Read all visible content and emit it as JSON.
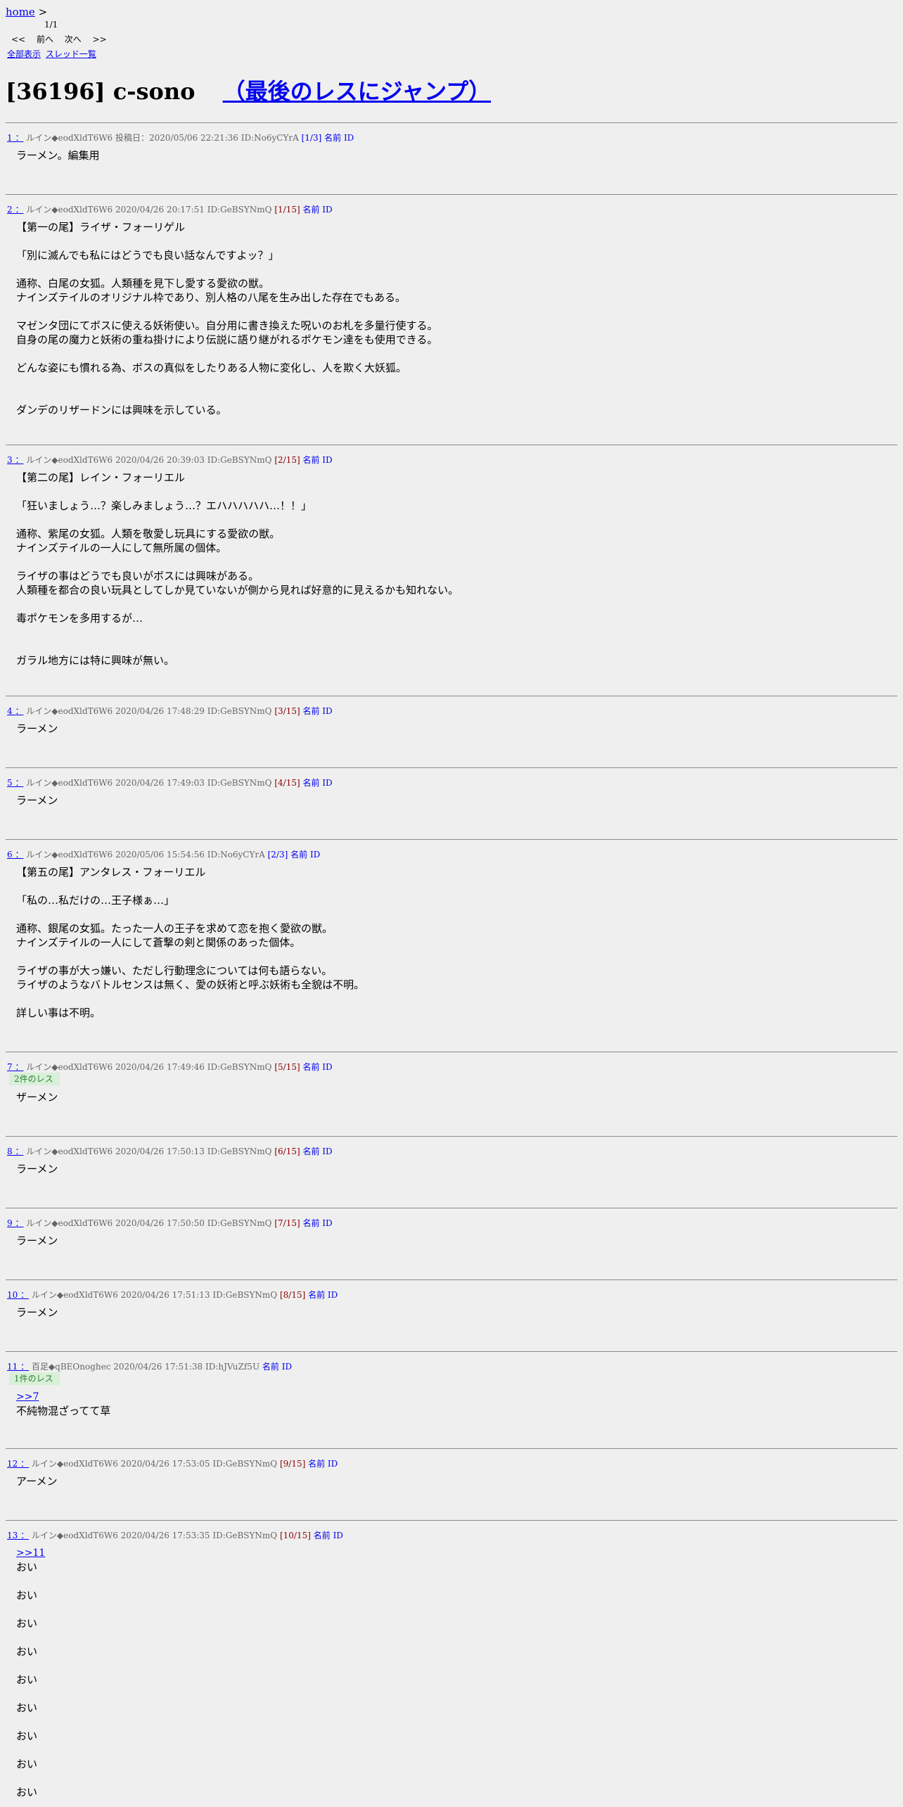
{
  "nav": {
    "home_label": "home",
    "home_sep": ">",
    "page_count": "1/1",
    "pager": [
      "<<",
      "前へ",
      "次へ",
      ">>"
    ],
    "links": [
      "全部表示",
      "スレッド一覧"
    ]
  },
  "thread": {
    "title": "[36196] c-sono",
    "jump_label": "（最後のレスにジャンプ）"
  },
  "posts": [
    {
      "num": "1 ：",
      "name": "ルイン◆eodXldT6W6",
      "info": "投稿日：2020/05/06 22:21:36 ID:No6yCYrA",
      "count": "[1/3]",
      "count_color": "blue",
      "name_id": "名前 ID",
      "badge": "",
      "lines": [
        "ラーメン。編集用"
      ]
    },
    {
      "num": "2 ：",
      "name": "ルイン◆eodXldT6W6",
      "info": "2020/04/26 20:17:51 ID:GeBSYNmQ",
      "count": "[1/15]",
      "count_color": "red",
      "name_id": "名前 ID",
      "badge": "",
      "lines": [
        "【第一の尾】ライザ・フォーリゲル",
        "",
        "「別に滅んでも私にはどうでも良い話なんですよッ？」",
        "",
        "通称、白尾の女狐。人類種を見下し愛する愛欲の獣。",
        "ナインズテイルのオリジナル枠であり、別人格の八尾を生み出した存在でもある。",
        "",
        "マゼンタ団にてボスに使える妖術使い。自分用に書き換えた呪いのお札を多量行使する。",
        "自身の尾の魔力と妖術の重ね掛けにより伝説に語り継がれるポケモン達をも使用できる。",
        "",
        "どんな姿にも慣れる為、ボスの真似をしたりある人物に変化し、人を欺く大妖狐。",
        "",
        "",
        "ダンデのリザードンには興味を示している。"
      ]
    },
    {
      "num": "3 ：",
      "name": "ルイン◆eodXldT6W6",
      "info": "2020/04/26 20:39:03 ID:GeBSYNmQ",
      "count": "[2/15]",
      "count_color": "red",
      "name_id": "名前 ID",
      "badge": "",
      "lines": [
        "【第二の尾】レイン・フォーリエル",
        "",
        "「狂いましょう…？楽しみましょう…？エハハハハハ…！！」",
        "",
        "通称、紫尾の女狐。人類を敬愛し玩具にする愛欲の獣。",
        "ナインズテイルの一人にして無所属の個体。",
        "",
        "ライザの事はどうでも良いがボスには興味がある。",
        "人類種を都合の良い玩具としてしか見ていないが側から見れば好意的に見えるかも知れない。",
        "",
        "毒ポケモンを多用するが…",
        "",
        "",
        "ガラル地方には特に興味が無い。"
      ]
    },
    {
      "num": "4 ：",
      "name": "ルイン◆eodXldT6W6",
      "info": "2020/04/26 17:48:29 ID:GeBSYNmQ",
      "count": "[3/15]",
      "count_color": "red",
      "name_id": "名前 ID",
      "badge": "",
      "lines": [
        "ラーメン"
      ]
    },
    {
      "num": "5 ：",
      "name": "ルイン◆eodXldT6W6",
      "info": "2020/04/26 17:49:03 ID:GeBSYNmQ",
      "count": "[4/15]",
      "count_color": "red",
      "name_id": "名前 ID",
      "badge": "",
      "lines": [
        "ラーメン"
      ]
    },
    {
      "num": "6 ：",
      "name": "ルイン◆eodXldT6W6",
      "info": "2020/05/06 15:54:56 ID:No6yCYrA",
      "count": "[2/3]",
      "count_color": "blue",
      "name_id": "名前 ID",
      "badge": "",
      "lines": [
        "【第五の尾】アンタレス・フォーリエル",
        "",
        "「私の…私だけの…王子様ぁ…」",
        "",
        "通称、銀尾の女狐。たった一人の王子を求めて恋を抱く愛欲の獣。",
        "ナインズテイルの一人にして蒼撃の剣と関係のあった個体。",
        "",
        "ライザの事が大っ嫌い、ただし行動理念については何も語らない。",
        "ライザのようなバトルセンスは無く、愛の妖術と呼ぶ妖術も全貌は不明。",
        "",
        "詳しい事は不明。"
      ]
    },
    {
      "num": "7 ：",
      "name": "ルイン◆eodXldT6W6",
      "info": "2020/04/26 17:49:46 ID:GeBSYNmQ",
      "count": "[5/15]",
      "count_color": "red",
      "name_id": "名前 ID",
      "badge": "2件のレス",
      "lines": [
        "ザーメン"
      ]
    },
    {
      "num": "8 ：",
      "name": "ルイン◆eodXldT6W6",
      "info": "2020/04/26 17:50:13 ID:GeBSYNmQ",
      "count": "[6/15]",
      "count_color": "red",
      "name_id": "名前 ID",
      "badge": "",
      "lines": [
        "ラーメン"
      ]
    },
    {
      "num": "9 ：",
      "name": "ルイン◆eodXldT6W6",
      "info": "2020/04/26 17:50:50 ID:GeBSYNmQ",
      "count": "[7/15]",
      "count_color": "red",
      "name_id": "名前 ID",
      "badge": "",
      "lines": [
        "ラーメン"
      ]
    },
    {
      "num": "10 ：",
      "name": "ルイン◆eodXldT6W6",
      "info": "2020/04/26 17:51:13 ID:GeBSYNmQ",
      "count": "[8/15]",
      "count_color": "red",
      "name_id": "名前 ID",
      "badge": "",
      "lines": [
        "ラーメン"
      ]
    },
    {
      "num": "11 ：",
      "name": "百足◆qBEOnoghec",
      "info": "2020/04/26 17:51:38 ID:hJVuZf5U",
      "count": "",
      "count_color": "blue",
      "name_id": "名前 ID",
      "badge": "1件のレス",
      "anchor": ">>7",
      "lines": [
        "不純物混ざってて草"
      ]
    },
    {
      "num": "12 ：",
      "name": "ルイン◆eodXldT6W6",
      "info": "2020/04/26 17:53:05 ID:GeBSYNmQ",
      "count": "[9/15]",
      "count_color": "red",
      "name_id": "名前 ID",
      "badge": "",
      "lines": [
        "アーメン"
      ]
    },
    {
      "num": "13 ：",
      "name": "ルイン◆eodXldT6W6",
      "info": "2020/04/26 17:53:35 ID:GeBSYNmQ",
      "count": "[10/15]",
      "count_color": "red",
      "name_id": "名前 ID",
      "badge": "",
      "anchor": ">>11",
      "lines": [
        "おい",
        "",
        "おい",
        "",
        "おい",
        "",
        "おい",
        "",
        "おい",
        "",
        "おい",
        "",
        "おい",
        "",
        "おい",
        "",
        "おい"
      ]
    }
  ]
}
